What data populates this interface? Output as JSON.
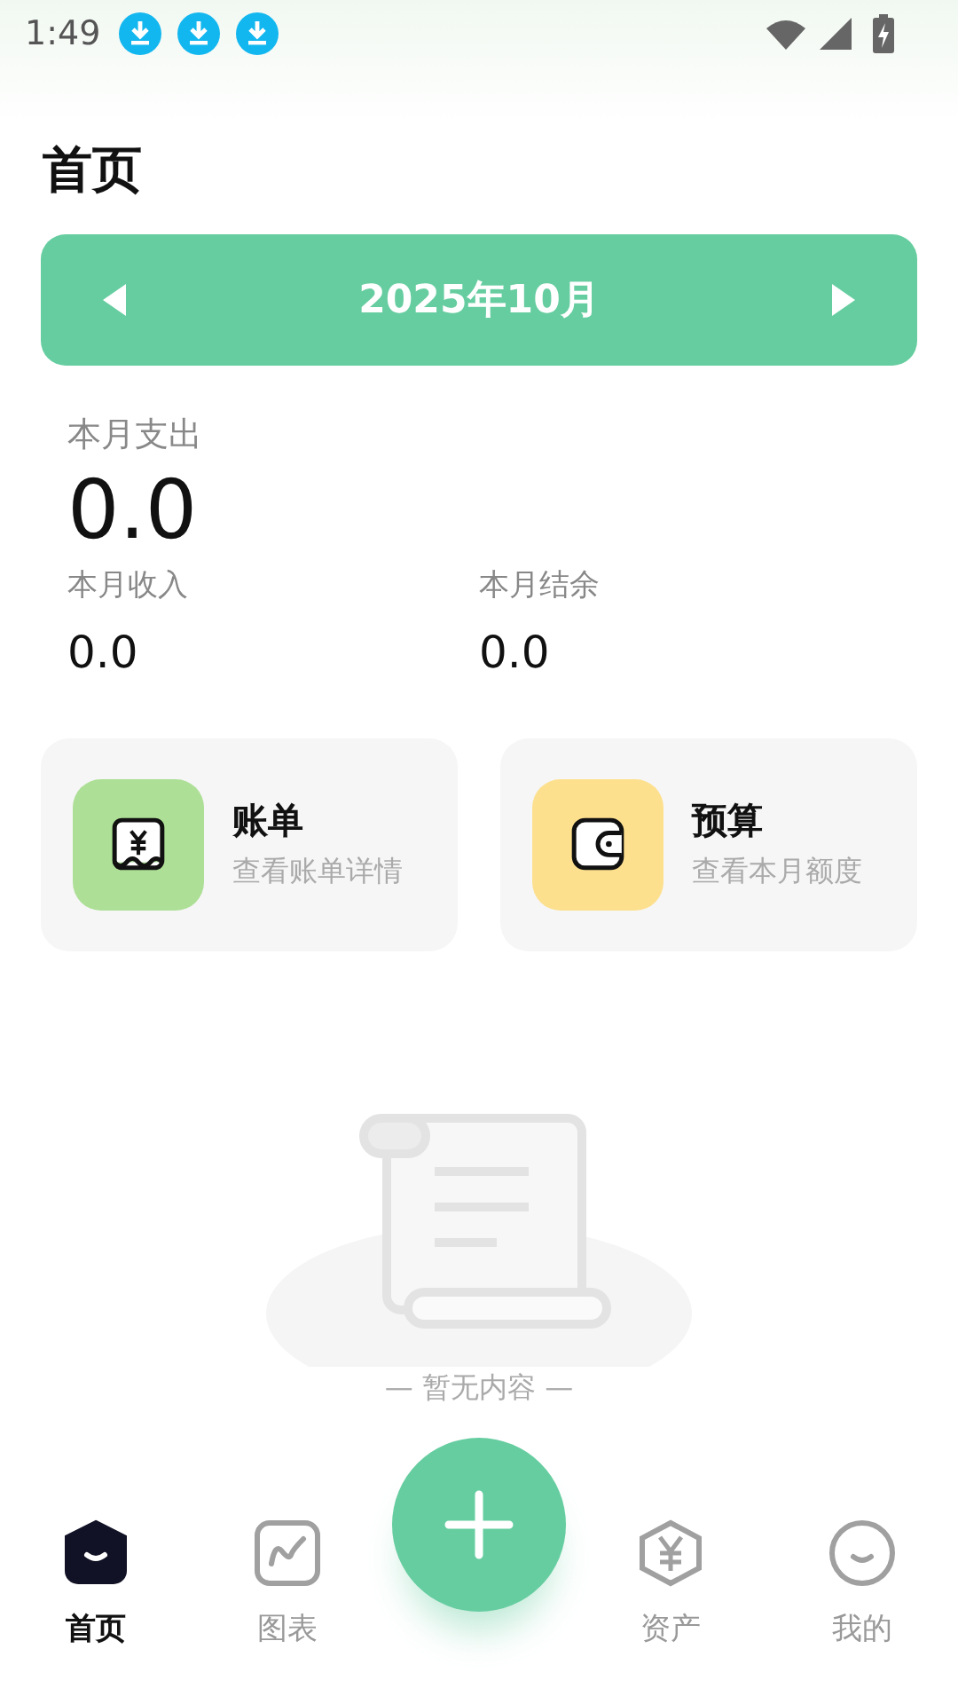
{
  "status_bar": {
    "time": "1:49",
    "notifications": [
      {
        "kind": "download"
      },
      {
        "kind": "download"
      },
      {
        "kind": "download"
      }
    ]
  },
  "title": "首页",
  "month_bar": {
    "label": "2025年10月"
  },
  "expense": {
    "label": "本月支出",
    "value": "0.0"
  },
  "summary": [
    {
      "label": "本月收入",
      "value": "0.0"
    },
    {
      "label": "本月结余",
      "value": "0.0"
    }
  ],
  "cards": [
    {
      "kind": "bill",
      "title": "账单",
      "subtitle": "查看账单详情",
      "color": "#addf96"
    },
    {
      "kind": "budget",
      "title": "预算",
      "subtitle": "查看本月额度",
      "color": "#fde08e"
    }
  ],
  "empty_state": {
    "text": "— 暂无内容 —"
  },
  "bottom_nav": [
    {
      "kind": "home",
      "label": "首页",
      "selected": true
    },
    {
      "kind": "chart",
      "label": "图表",
      "selected": false
    },
    {
      "kind": "add"
    },
    {
      "kind": "assets",
      "label": "资产",
      "selected": false
    },
    {
      "kind": "profile",
      "label": "我的",
      "selected": false
    }
  ]
}
